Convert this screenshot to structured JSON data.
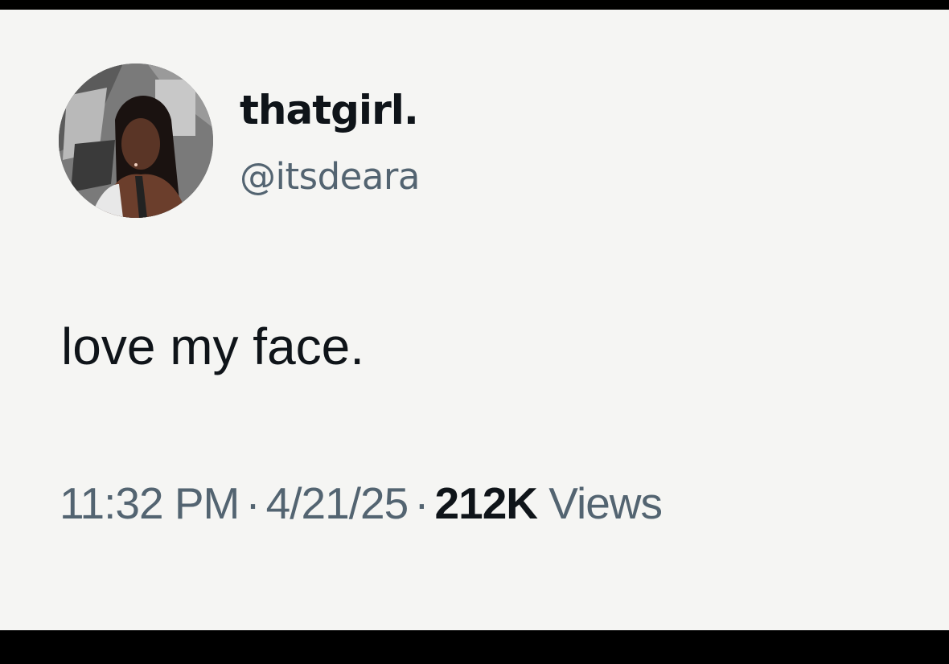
{
  "tweet": {
    "display_name": "thatgirl.",
    "handle": "@itsdeara",
    "text": "love my face.",
    "time": "11:32 PM",
    "date": "4/21/25",
    "views_count": "212K",
    "views_label": "Views",
    "separator": "·"
  },
  "colors": {
    "background": "#f5f5f3",
    "primary_text": "#0f1419",
    "secondary_text": "#536471"
  }
}
